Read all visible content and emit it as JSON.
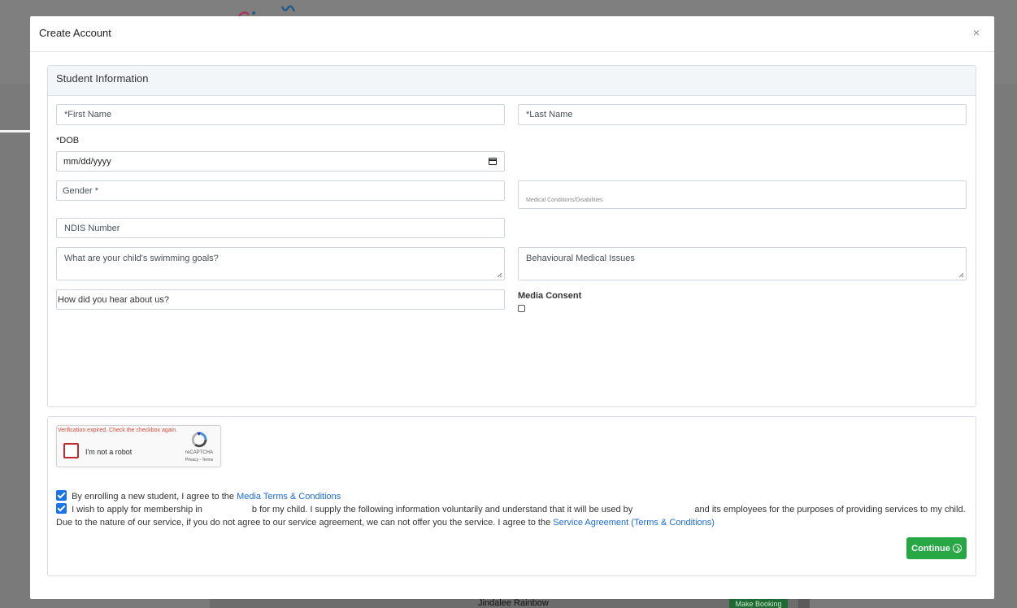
{
  "modal": {
    "title": "Create Account",
    "close_glyph": "×"
  },
  "student_panel": {
    "heading": "Student Information",
    "fields": {
      "first_name_placeholder": "*First Name",
      "last_name_placeholder": "*Last Name",
      "dob_label": "*DOB",
      "dob_placeholder": "mm/dd/yyyy",
      "gender_placeholder": "Gender *",
      "medical_placeholder": "Medical Conditions/Disabilities",
      "ndis_placeholder": "NDIS Number",
      "swimming_goals_placeholder": "What are your child's swimming goals?",
      "behavioural_placeholder": "Behavioural Medical Issues",
      "hear_about_placeholder": "How did you hear about us?",
      "media_consent_label": "Media Consent",
      "media_consent_checked": false
    }
  },
  "recaptcha": {
    "error": "Verification expired. Check the checkbox again.",
    "label": "I'm not a robot",
    "brand": "reCAPTCHA",
    "terms": "Privacy - Terms"
  },
  "agreements": {
    "media_text": "By enrolling a new student, I agree to the",
    "media_link": "Media Terms & Conditions",
    "membership_text_1": "I wish to apply for membership in",
    "membership_text_2": "b for my child. I supply the following information voluntarily and understand that it will be used by",
    "membership_text_3": "and its employees for the purposes of providing services to my child. Due to the nature of our service, if you do not agree to our service agreement, we can not offer you the service. I agree to the",
    "service_link": "Service Agreement (Terms & Conditions)"
  },
  "continue_label": "Continue",
  "background": {
    "table_cell_rainbow": "Jindalee Rainbow",
    "make_booking": "Make Booking"
  },
  "colors": {
    "accent_green": "#28a745",
    "link_blue": "#1a6ad8",
    "error_red": "#d14836"
  }
}
